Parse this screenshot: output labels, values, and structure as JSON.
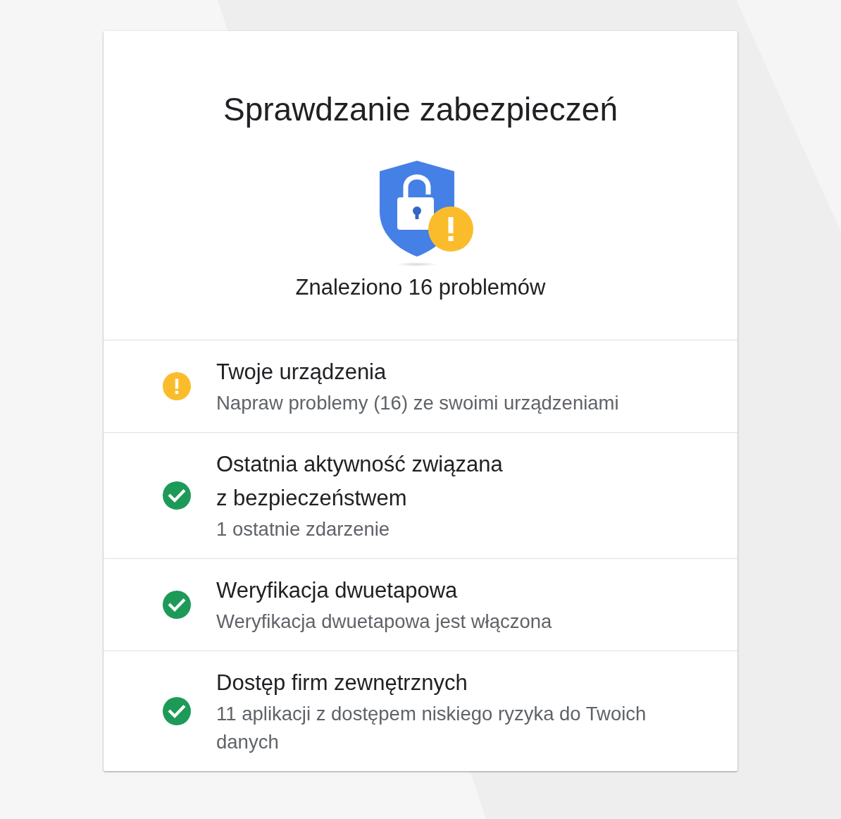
{
  "title": "Sprawdzanie zabezpieczeń",
  "summary": "Znaleziono 16 problemów",
  "items": [
    {
      "kind": "warning",
      "title": "Twoje urządzenia",
      "description": "Napraw problemy (16) ze swoimi urządzeniami"
    },
    {
      "kind": "ok",
      "title": "Ostatnia aktywność związana z bezpieczeństwem",
      "description": "1 ostatnie zdarzenie"
    },
    {
      "kind": "ok",
      "title": "Weryfikacja dwuetapowa",
      "description": "Weryfikacja dwuetapowa jest włączona"
    },
    {
      "kind": "ok",
      "title": "Dostęp firm zewnętrznych",
      "description": "11 aplikacji z dostępem niskiego ryzyka do Twoich danych"
    }
  ]
}
